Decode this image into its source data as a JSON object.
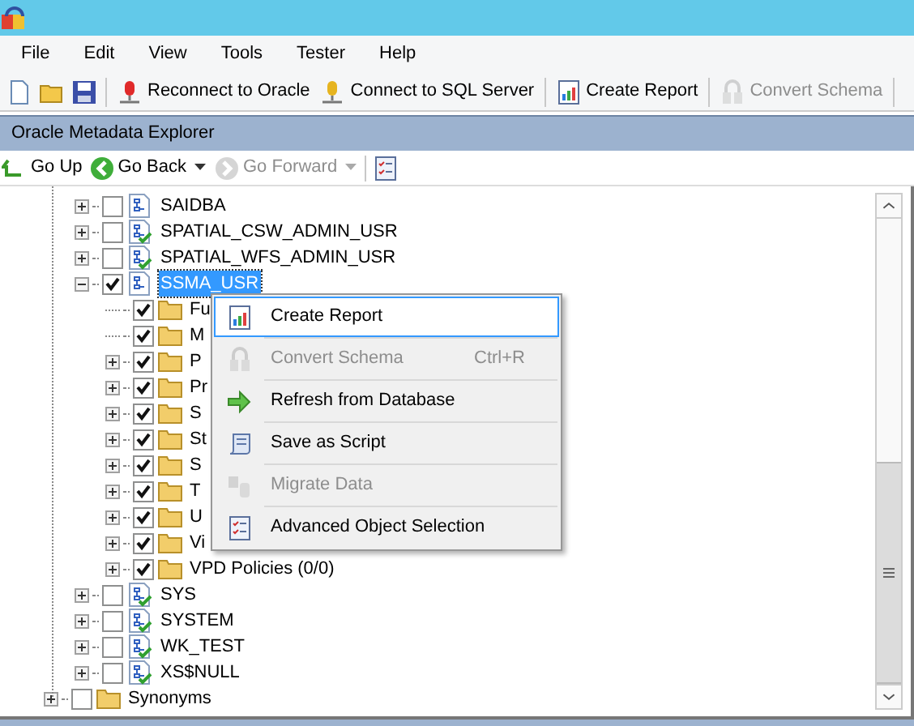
{
  "menu_bar": [
    {
      "label": "File"
    },
    {
      "label": "Edit"
    },
    {
      "label": "View"
    },
    {
      "label": "Tools"
    },
    {
      "label": "Tester"
    },
    {
      "label": "Help"
    }
  ],
  "toolbar": [
    {
      "kind": "new"
    },
    {
      "kind": "open"
    },
    {
      "kind": "save"
    },
    {
      "kind": "sep"
    },
    {
      "kind": "oracle",
      "label": "Reconnect to Oracle",
      "disabled": false
    },
    {
      "kind": "sql",
      "label": "Connect to SQL Server",
      "disabled": false
    },
    {
      "kind": "sep"
    },
    {
      "kind": "report",
      "label": "Create Report",
      "disabled": false
    },
    {
      "kind": "sep"
    },
    {
      "kind": "convert",
      "label": "Convert Schema",
      "disabled": true
    },
    {
      "kind": "sep"
    }
  ],
  "panel": {
    "title": "Oracle Metadata Explorer"
  },
  "nav": [
    {
      "kind": "up",
      "label": "Go Up",
      "disabled": false
    },
    {
      "kind": "back",
      "label": "Go Back",
      "disabled": false,
      "dropdown": true
    },
    {
      "kind": "forward",
      "label": "Go Forward",
      "disabled": true,
      "dropdown": true
    },
    {
      "kind": "sep"
    },
    {
      "kind": "select"
    }
  ],
  "tree": [
    {
      "label": "SAIDBA",
      "kind": "schema",
      "checked": false,
      "expanded": false,
      "selected": false,
      "converted": false
    },
    {
      "label": "SPATIAL_CSW_ADMIN_USR",
      "kind": "schema",
      "checked": false,
      "expanded": false,
      "selected": false,
      "converted": true
    },
    {
      "label": "SPATIAL_WFS_ADMIN_USR",
      "kind": "schema",
      "checked": false,
      "expanded": false,
      "selected": false,
      "converted": true
    },
    {
      "label": "SSMA_USR",
      "kind": "schema",
      "checked": true,
      "expanded": true,
      "selected": true,
      "converted": false,
      "children": [
        {
          "label": "Fu",
          "kind": "folder",
          "checked": true,
          "expandable": false
        },
        {
          "label": "M",
          "kind": "folder",
          "checked": true,
          "expandable": false
        },
        {
          "label": "P",
          "kind": "folder",
          "checked": true,
          "expandable": true
        },
        {
          "label": "Pr",
          "kind": "folder",
          "checked": true,
          "expandable": true
        },
        {
          "label": "S",
          "kind": "folder",
          "checked": true,
          "expandable": true
        },
        {
          "label": "St",
          "kind": "folder",
          "checked": true,
          "expandable": true
        },
        {
          "label": "S",
          "kind": "folder",
          "checked": true,
          "expandable": true
        },
        {
          "label": "T",
          "kind": "folder",
          "checked": true,
          "expandable": true
        },
        {
          "label": "U",
          "kind": "folder",
          "checked": true,
          "expandable": true
        },
        {
          "label": "Vi",
          "kind": "folder",
          "checked": true,
          "expandable": true
        },
        {
          "label": "VPD Policies (0/0)",
          "kind": "folder",
          "checked": true,
          "expandable": true
        }
      ]
    },
    {
      "label": "SYS",
      "kind": "schema",
      "checked": false,
      "expanded": false,
      "selected": false,
      "converted": true
    },
    {
      "label": "SYSTEM",
      "kind": "schema",
      "checked": false,
      "expanded": false,
      "selected": false,
      "converted": true
    },
    {
      "label": "WK_TEST",
      "kind": "schema",
      "checked": false,
      "expanded": false,
      "selected": false,
      "converted": true
    },
    {
      "label": "XS$NULL",
      "kind": "schema",
      "checked": false,
      "expanded": false,
      "selected": false,
      "converted": true
    }
  ],
  "tree_root": [
    {
      "label": "Synonyms",
      "kind": "folder",
      "checked": false,
      "expandable": true
    }
  ],
  "context_menu": [
    {
      "kind": "report",
      "label": "Create Report",
      "disabled": false,
      "selected": true
    },
    {
      "kind": "convert",
      "label": "Convert Schema",
      "shortcut": "Ctrl+R",
      "disabled": true,
      "selected": false
    },
    {
      "kind": "refresh",
      "label": "Refresh from Database",
      "disabled": false,
      "selected": false
    },
    {
      "kind": "script",
      "label": "Save as Script",
      "disabled": false,
      "selected": false
    },
    {
      "kind": "migrate",
      "label": "Migrate Data",
      "disabled": true,
      "selected": false
    },
    {
      "kind": "select",
      "label": "Advanced Object Selection",
      "disabled": false,
      "selected": false
    }
  ]
}
